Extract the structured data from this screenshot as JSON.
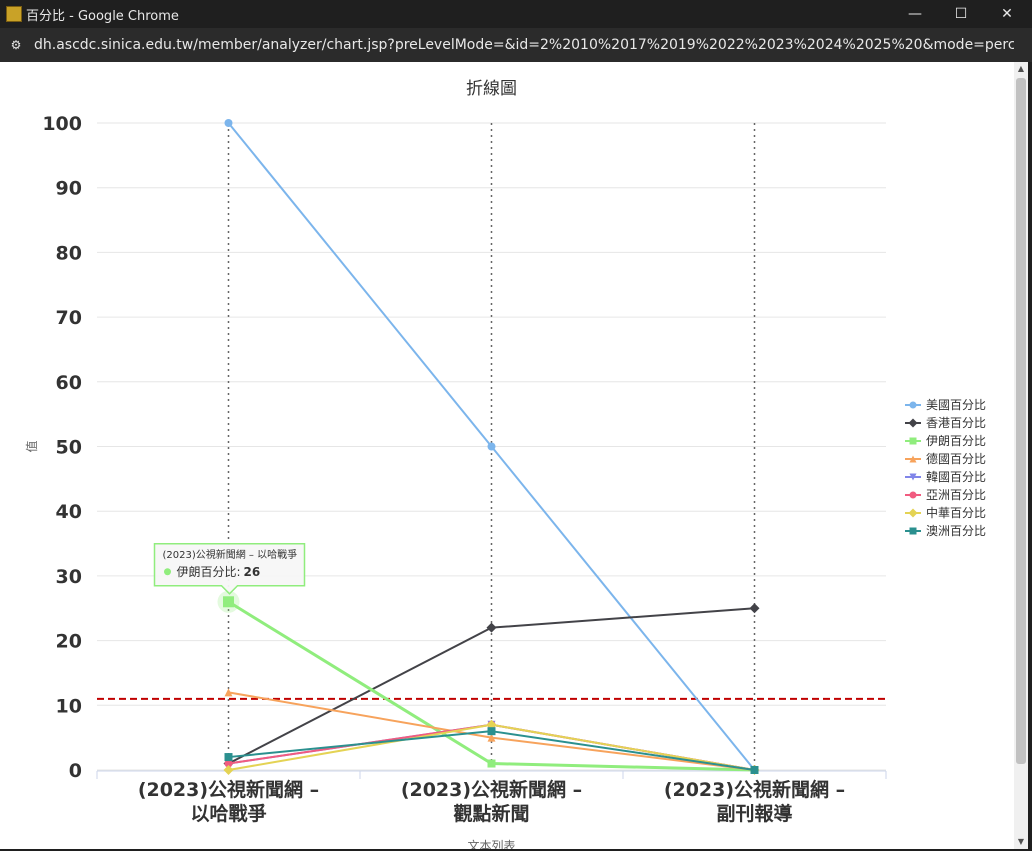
{
  "window": {
    "title": "百分比 - Google Chrome",
    "controls": {
      "minimize": "—",
      "maximize": "☐",
      "close": "✕"
    }
  },
  "address_bar": {
    "url": "dh.ascdc.sinica.edu.tw/member/analyzer/chart.jsp?preLevelMode=&id=2%2010%2017%2019%2022%2023%2024%2025%20&mode=percentage..."
  },
  "tooltip": {
    "title": "(2023)公視新聞網 – 以哈戰爭",
    "series": "伊朗百分比",
    "value": "26",
    "color": "#90ed7d"
  },
  "chart_data": {
    "type": "line",
    "title": "折線圖",
    "ylabel": "值",
    "xlabel": "文本列表",
    "ylim": [
      0,
      100
    ],
    "yticks": [
      0,
      10,
      20,
      30,
      40,
      50,
      60,
      70,
      80,
      90,
      100
    ],
    "categories": [
      [
        "(2023)公視新聞網 –",
        "以哈戰爭"
      ],
      [
        "(2023)公視新聞網 –",
        "觀點新聞"
      ],
      [
        "(2023)公視新聞網 –",
        "副刊報導"
      ]
    ],
    "reference_line": {
      "value": 11,
      "color": "#c00000",
      "style": "dashed"
    },
    "series": [
      {
        "name": "美國百分比",
        "color": "#7cb5ec",
        "marker": "circle",
        "values": [
          100,
          50,
          0
        ]
      },
      {
        "name": "香港百分比",
        "color": "#434348",
        "marker": "diamond",
        "values": [
          1,
          22,
          25
        ]
      },
      {
        "name": "伊朗百分比",
        "color": "#90ed7d",
        "marker": "square",
        "values": [
          26,
          1,
          0
        ]
      },
      {
        "name": "德國百分比",
        "color": "#f7a35c",
        "marker": "triangle",
        "values": [
          12,
          5,
          0
        ]
      },
      {
        "name": "韓國百分比",
        "color": "#8085e9",
        "marker": "triangle-down",
        "values": [
          1,
          7,
          0
        ]
      },
      {
        "name": "亞洲百分比",
        "color": "#f15c80",
        "marker": "circle",
        "values": [
          1,
          7,
          0
        ]
      },
      {
        "name": "中華百分比",
        "color": "#e4d354",
        "marker": "diamond",
        "values": [
          0,
          7,
          0
        ]
      },
      {
        "name": "澳洲百分比",
        "color": "#2b908f",
        "marker": "square",
        "values": [
          2,
          6,
          0
        ]
      }
    ]
  }
}
